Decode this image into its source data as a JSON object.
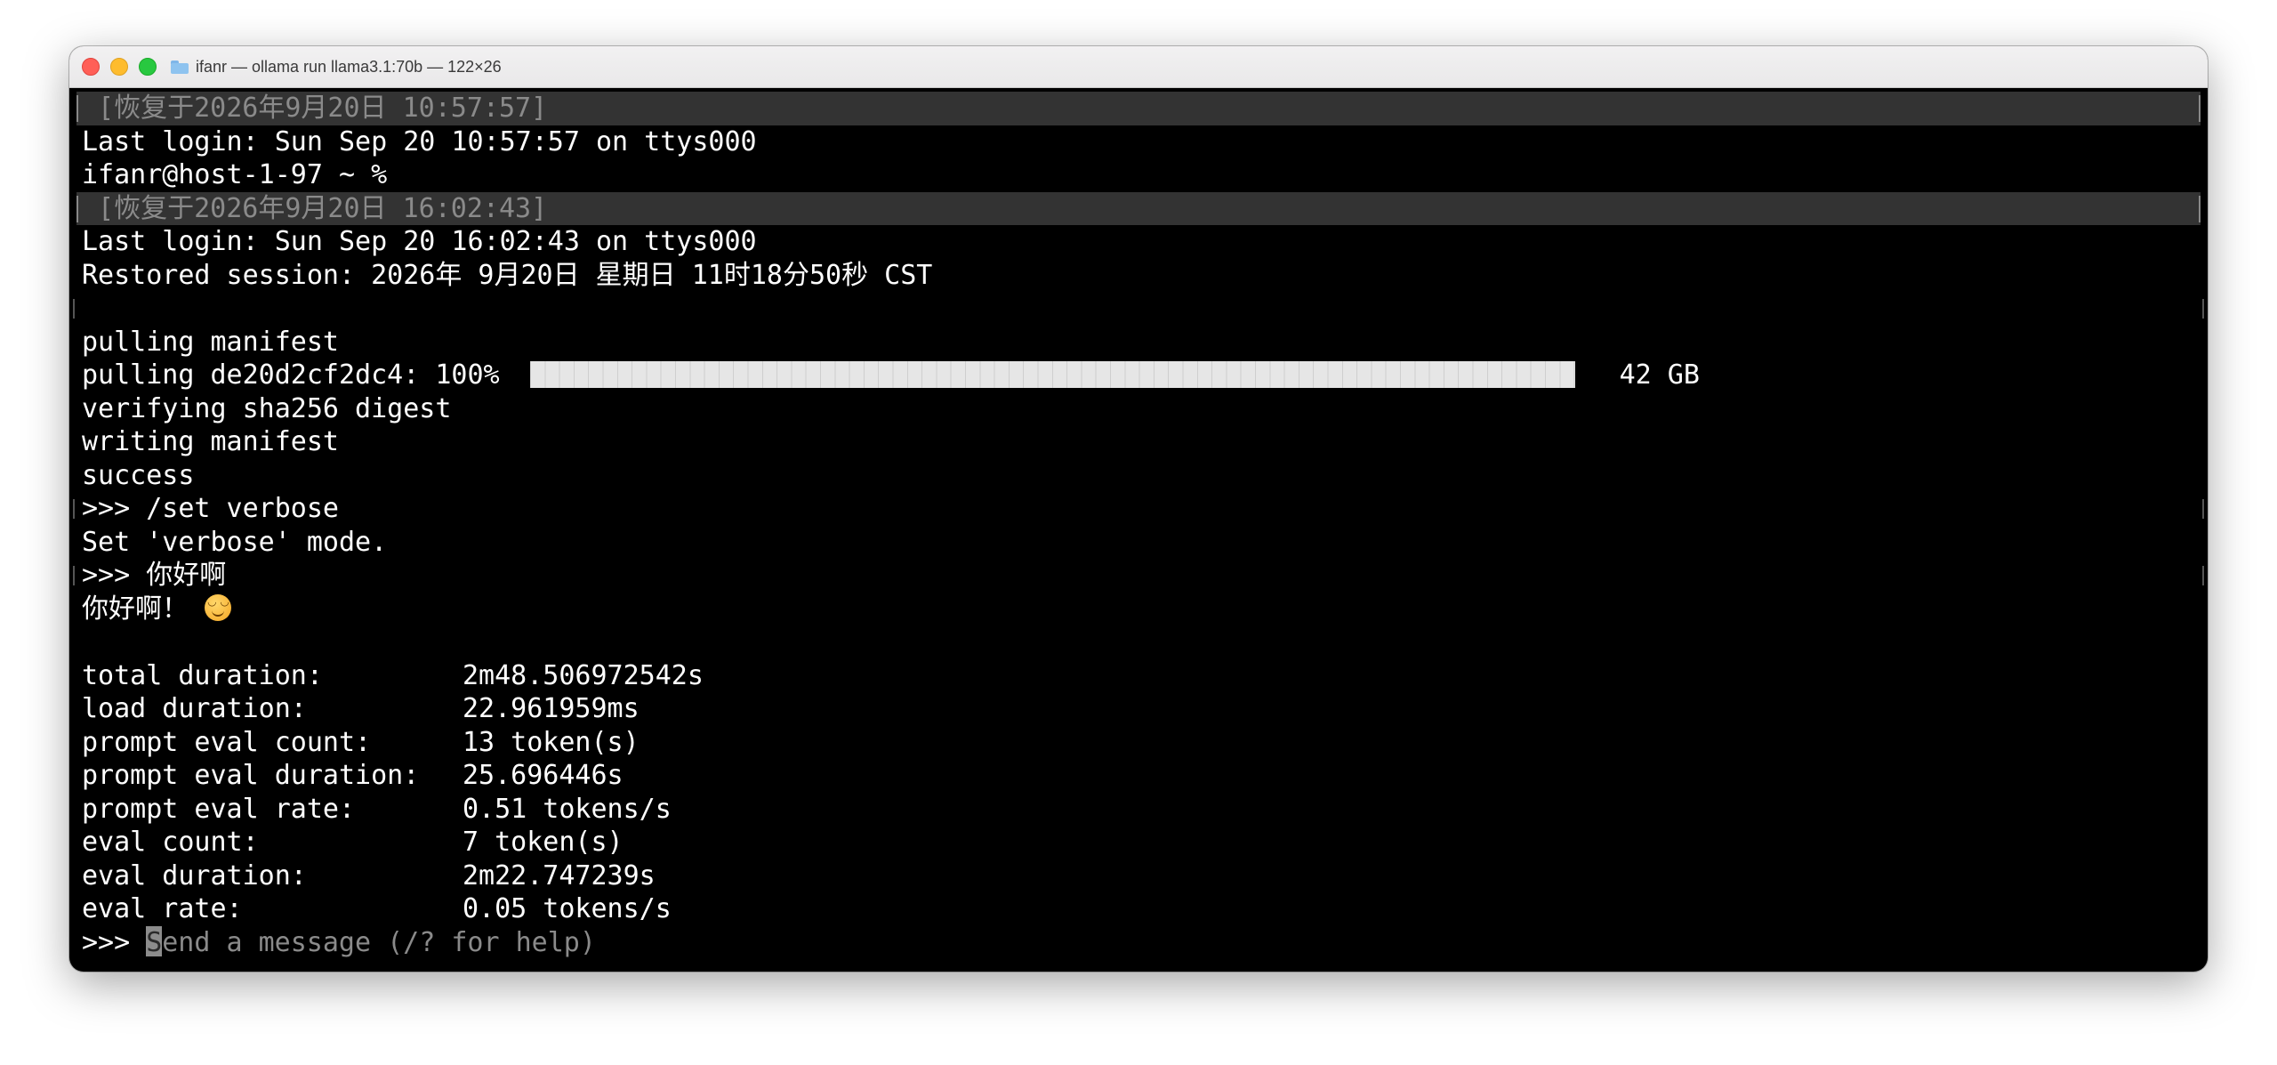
{
  "window": {
    "title": "ifanr — ollama run llama3.1:70b — 122×26",
    "folder_icon": "folder-icon"
  },
  "terminal": {
    "restored_1": " [恢复于2026年9月20日 10:57:57]",
    "last_login_1": "Last login: Sun Sep 20 10:57:57 on ttys000",
    "prompt_1": "ifanr@host-1-97 ~ %",
    "restored_2": " [恢复于2026年9月20日 16:02:43]",
    "last_login_2": "Last login: Sun Sep 20 16:02:43 on ttys000",
    "restored_session": "Restored session: 2026年 9月20日 星期日 11时18分50秒 CST",
    "pulling_manifest": "pulling manifest",
    "pulling_layer": "pulling de20d2cf2dc4: 100%",
    "pull_progress": 1.0,
    "pull_size": "42 GB",
    "verifying": "verifying sha256 digest",
    "writing_manifest": "writing manifest",
    "success": "success",
    "cmd_verbose": ">>> /set verbose",
    "verbose_set": "Set 'verbose' mode.",
    "cmd_hello": ">>> 你好啊",
    "reply": "你好啊！ ",
    "reply_emoji": "smiling-face-emoji",
    "stats": [
      {
        "label": "total duration:",
        "value": "2m48.506972542s"
      },
      {
        "label": "load duration:",
        "value": "22.961959ms"
      },
      {
        "label": "prompt eval count:",
        "value": "13 token(s)"
      },
      {
        "label": "prompt eval duration:",
        "value": "25.696446s"
      },
      {
        "label": "prompt eval rate:",
        "value": "0.51 tokens/s"
      },
      {
        "label": "eval count:",
        "value": "7 token(s)"
      },
      {
        "label": "eval duration:",
        "value": "2m22.747239s"
      },
      {
        "label": "eval rate:",
        "value": "0.05 tokens/s"
      }
    ],
    "input_prompt": ">>> ",
    "input_placeholder_first": "S",
    "input_placeholder_rest": "end a message (/? for help)"
  }
}
